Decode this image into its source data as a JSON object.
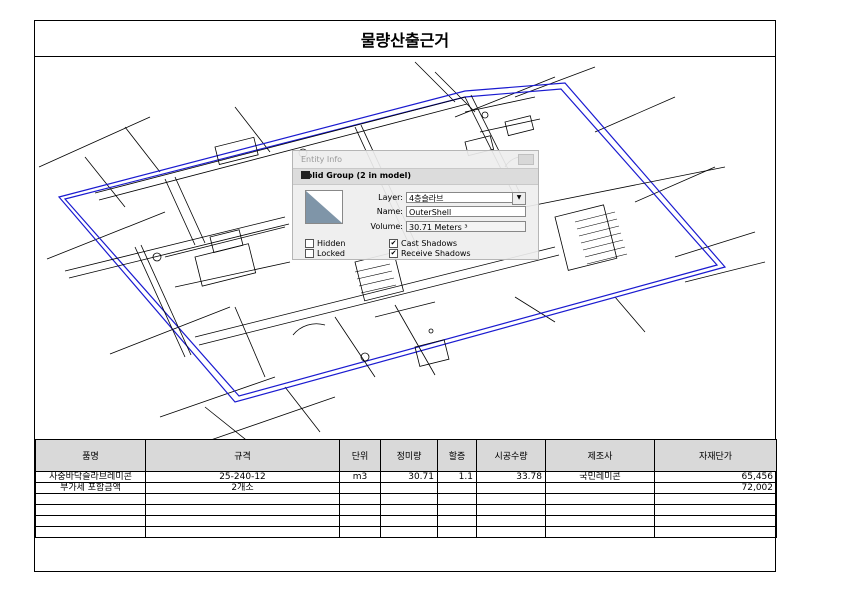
{
  "title": "물량산출근거",
  "entity_info": {
    "window_title": "Entity Info",
    "header": "Solid Group (2 in model)",
    "layer_label": "Layer:",
    "layer_value": "4층슬라브",
    "name_label": "Name:",
    "name_value": "OuterShell",
    "volume_label": "Volume:",
    "volume_value": "30.71 Meters ³",
    "hidden_label": "Hidden",
    "locked_label": "Locked",
    "cast_label": "Cast Shadows",
    "receive_label": "Receive Shadows",
    "hidden_checked": false,
    "locked_checked": false,
    "cast_checked": true,
    "receive_checked": true
  },
  "table": {
    "headers": [
      "품명",
      "규격",
      "단위",
      "정미량",
      "할증",
      "시공수량",
      "제조사",
      "자재단가"
    ],
    "rows": [
      [
        "사중바닥슬라브레미콘",
        "25-240-12",
        "m3",
        "30.71",
        "1.1",
        "33.78",
        "국민레미콘",
        "65,456"
      ],
      [
        "부가세 포함금액",
        "2개소",
        "",
        "",
        "",
        "",
        "",
        "72,002"
      ],
      [
        "",
        "",
        "",
        "",
        "",
        "",
        "",
        ""
      ],
      [
        "",
        "",
        "",
        "",
        "",
        "",
        "",
        ""
      ],
      [
        "",
        "",
        "",
        "",
        "",
        "",
        "",
        ""
      ],
      [
        "",
        "",
        "",
        "",
        "",
        "",
        "",
        ""
      ]
    ]
  },
  "colors": {
    "outline_blue": "#1a1ad0",
    "header_gray": "#d9d9d9"
  }
}
